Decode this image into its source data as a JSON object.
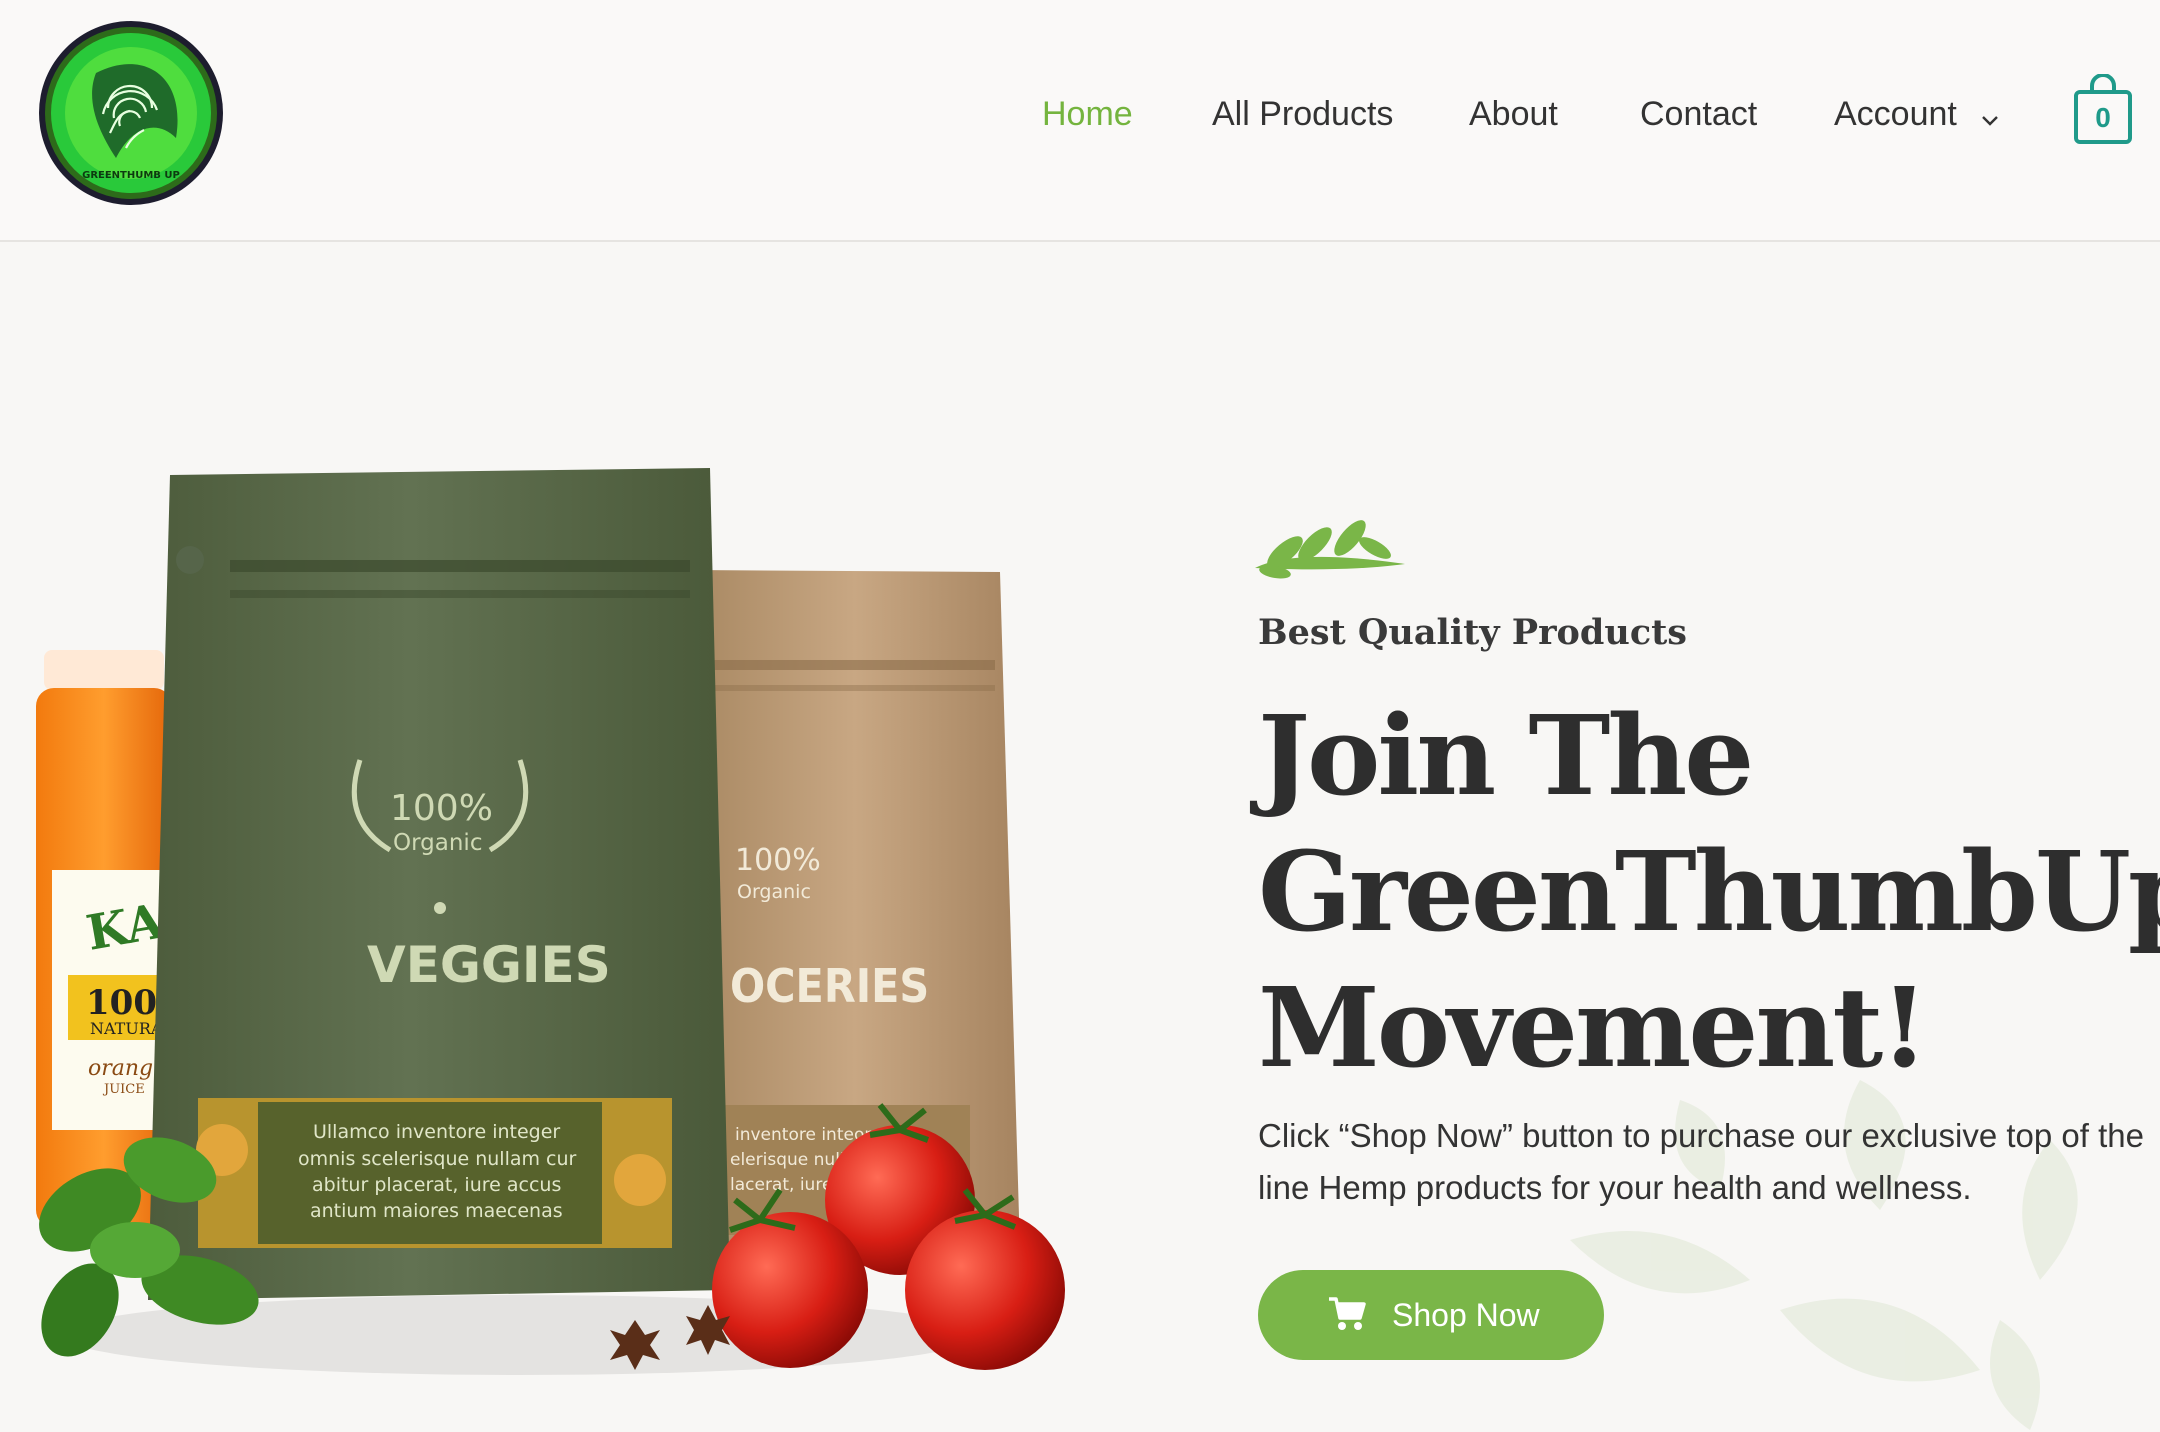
{
  "brand": {
    "logo_text": "GREENTHUMB UP"
  },
  "nav": {
    "items": [
      {
        "label": "Home",
        "active": true
      },
      {
        "label": "All Products"
      },
      {
        "label": "About"
      },
      {
        "label": "Contact"
      },
      {
        "label": "Account",
        "has_dropdown": true
      }
    ],
    "cart_count": "0"
  },
  "hero": {
    "eyebrow": "Best Quality Products",
    "headline": [
      "Join The",
      "GreenThumbUp",
      "Movement!"
    ],
    "description": [
      "Click “Shop Now” button to purchase our exclusive top of the",
      "line Hemp products for your health and wellness."
    ],
    "button_label": "Shop Now",
    "product_image": {
      "green_bag": {
        "badge_pct": "100%",
        "badge_word": "Organic",
        "title": "VEGGIES",
        "panel_lines": [
          "Ullamco inventore integer",
          "omnis scelerisque nullam cur",
          "abitur placerat, iure accus",
          "antium maiores maecenas"
        ]
      },
      "tan_bag": {
        "badge_pct": "100%",
        "badge_word": "Organic",
        "title": "OCERIES",
        "panel_lines": [
          "inventore inteor",
          "elerisque null",
          "lacerat, iure"
        ]
      },
      "jar": {
        "brand": "KARI",
        "big": "100",
        "sub": "NATURA",
        "flavor": "orang",
        "flavor2": "JUICE"
      }
    }
  },
  "colors": {
    "accent": "#7ab648",
    "cart": "#1f9a8a",
    "text": "#333333"
  }
}
